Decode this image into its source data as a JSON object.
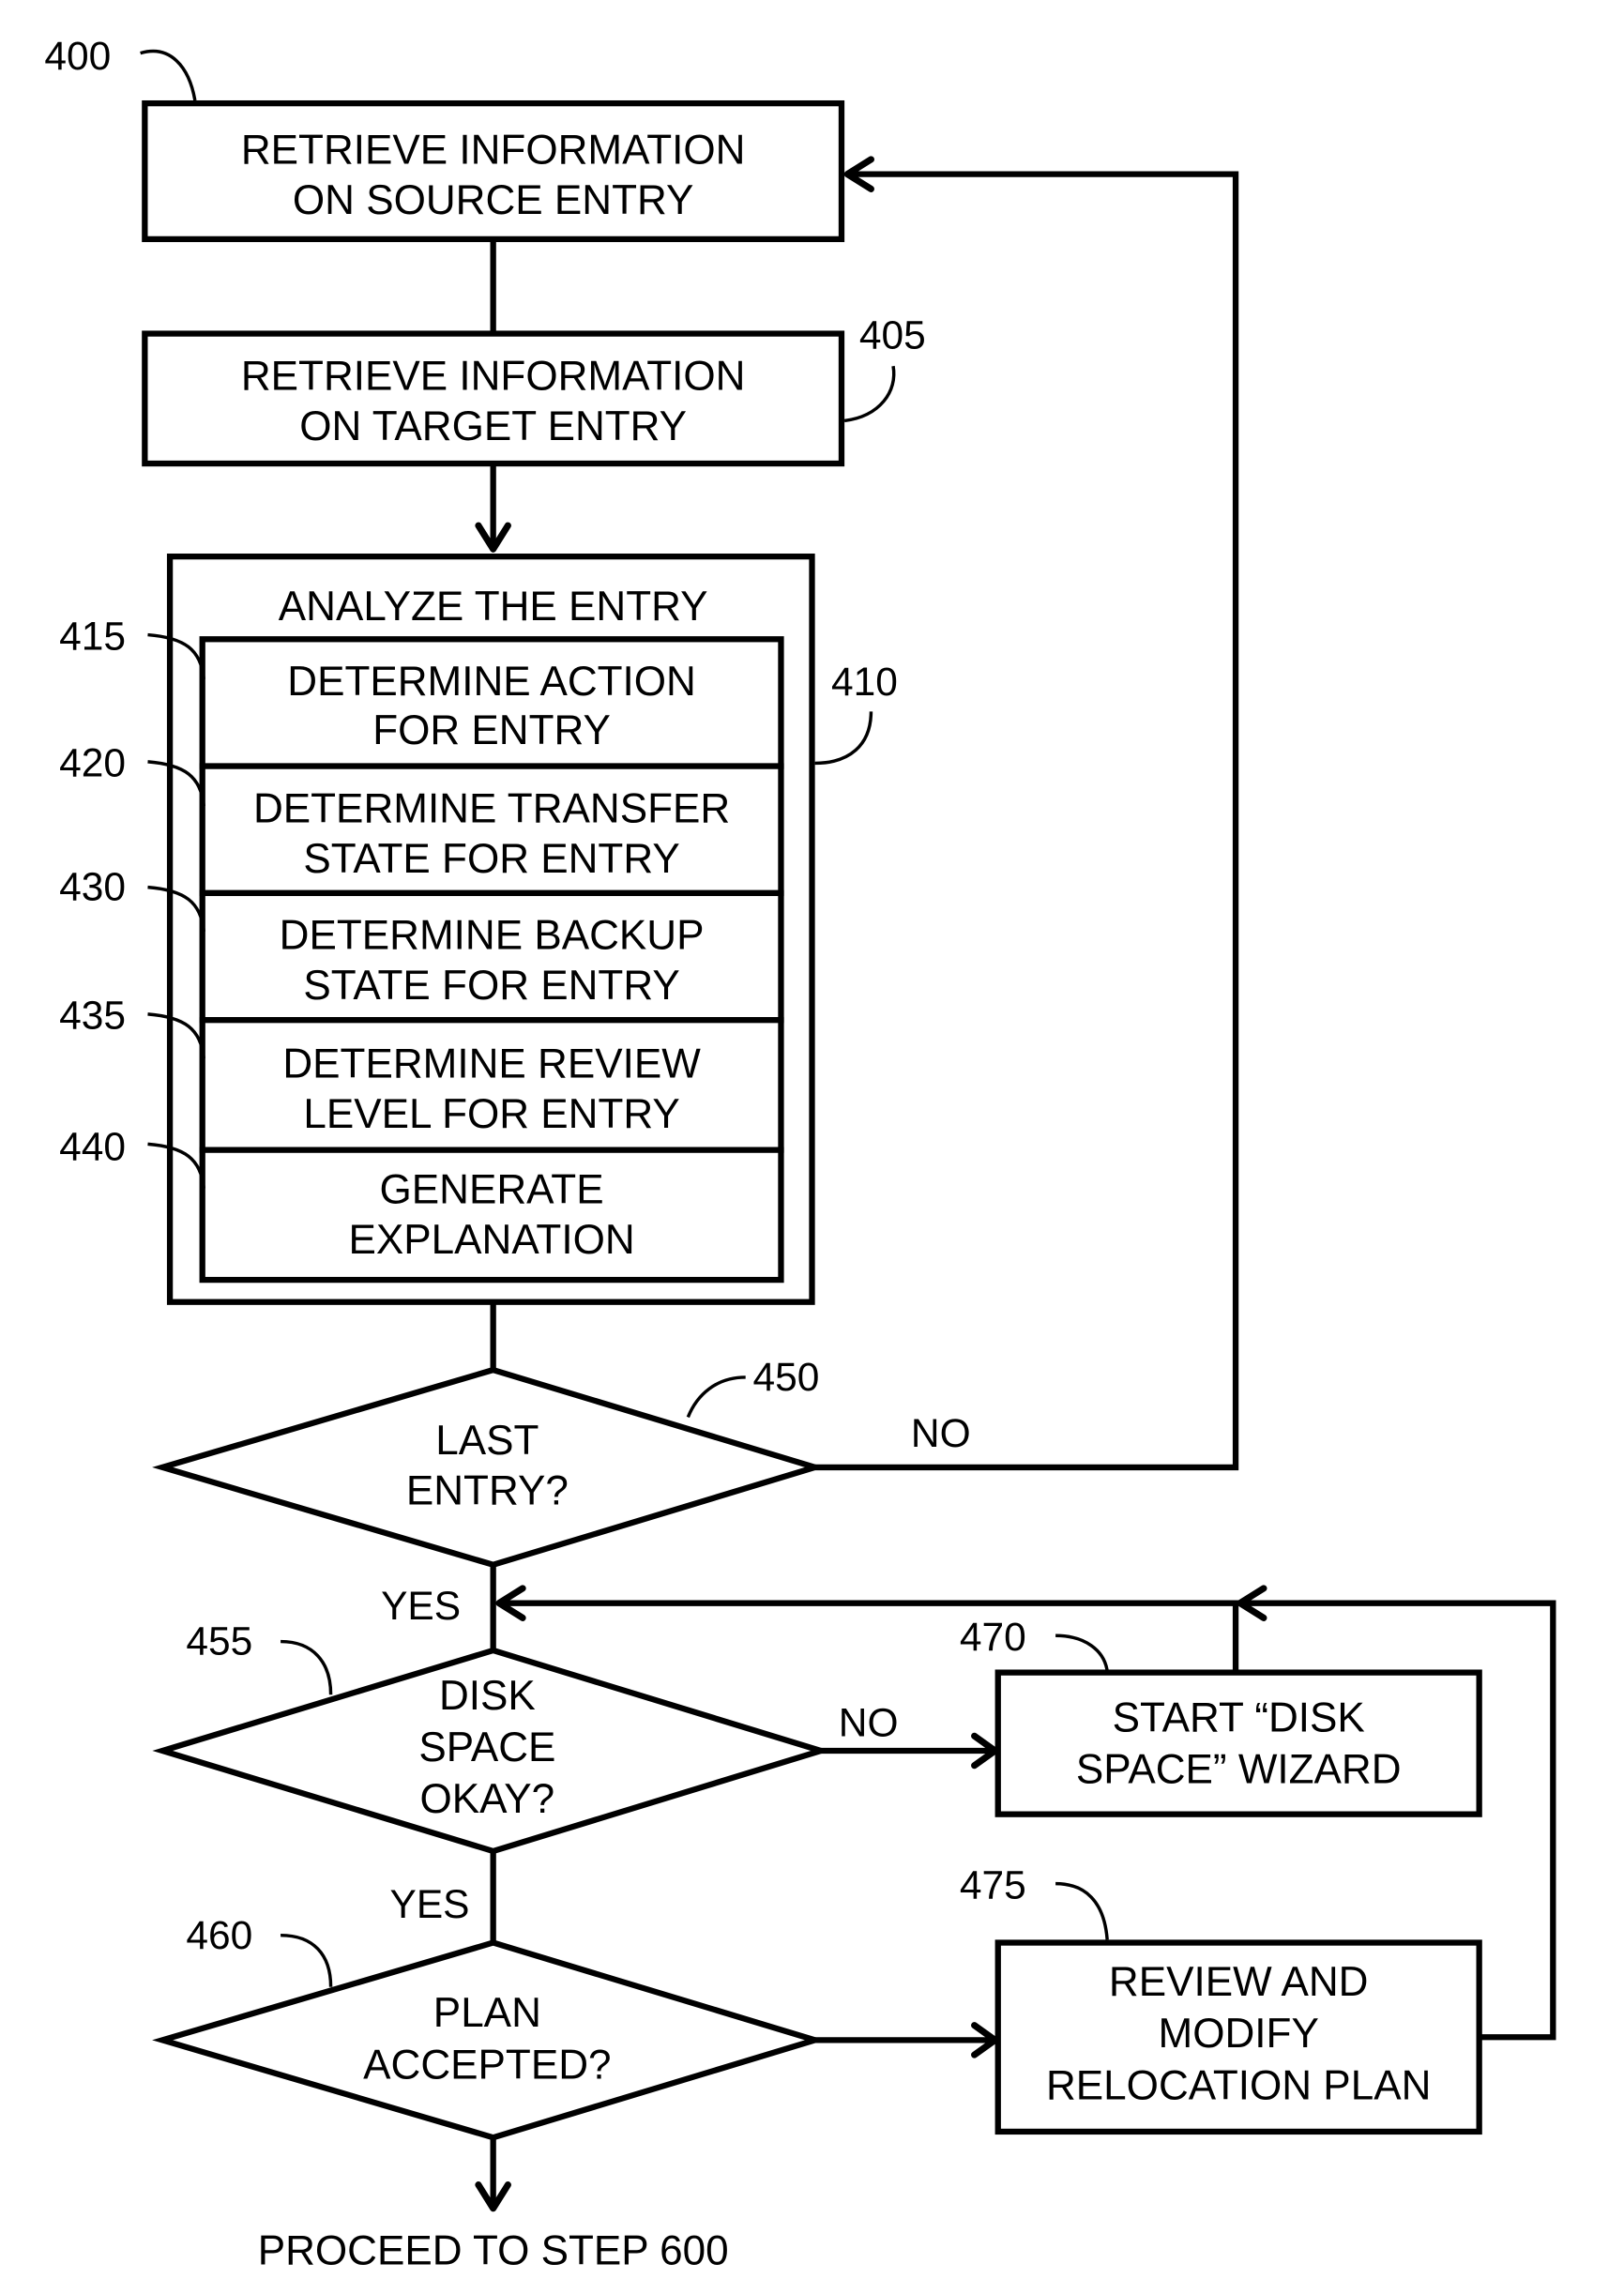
{
  "figure": {
    "ref": "400",
    "steps": {
      "s400": {
        "lines": [
          "RETRIEVE INFORMATION",
          "ON SOURCE ENTRY"
        ]
      },
      "s405": {
        "ref": "405",
        "lines": [
          "RETRIEVE INFORMATION",
          "ON TARGET ENTRY"
        ]
      },
      "s410": {
        "ref": "410",
        "title": "ANALYZE THE ENTRY",
        "substeps": [
          {
            "ref": "415",
            "lines": [
              "DETERMINE ACTION",
              "FOR ENTRY"
            ]
          },
          {
            "ref": "420",
            "lines": [
              "DETERMINE TRANSFER",
              "STATE FOR ENTRY"
            ]
          },
          {
            "ref": "430",
            "lines": [
              "DETERMINE BACKUP",
              "STATE FOR ENTRY"
            ]
          },
          {
            "ref": "435",
            "lines": [
              "DETERMINE REVIEW",
              "LEVEL FOR ENTRY"
            ]
          },
          {
            "ref": "440",
            "lines": [
              "GENERATE",
              "EXPLANATION"
            ]
          }
        ]
      },
      "s450": {
        "ref": "450",
        "lines": [
          "LAST",
          "ENTRY?"
        ],
        "no": "NO",
        "yes": "YES"
      },
      "s455": {
        "ref": "455",
        "lines": [
          "DISK",
          "SPACE",
          "OKAY?"
        ],
        "no": "NO",
        "yes": "YES"
      },
      "s460": {
        "ref": "460",
        "lines": [
          "PLAN",
          "ACCEPTED?"
        ]
      },
      "s470": {
        "ref": "470",
        "lines": [
          "START “DISK",
          "SPACE” WIZARD"
        ]
      },
      "s475": {
        "ref": "475",
        "lines": [
          "REVIEW AND",
          "MODIFY",
          "RELOCATION PLAN"
        ]
      }
    },
    "terminal": "PROCEED TO STEP 600"
  }
}
